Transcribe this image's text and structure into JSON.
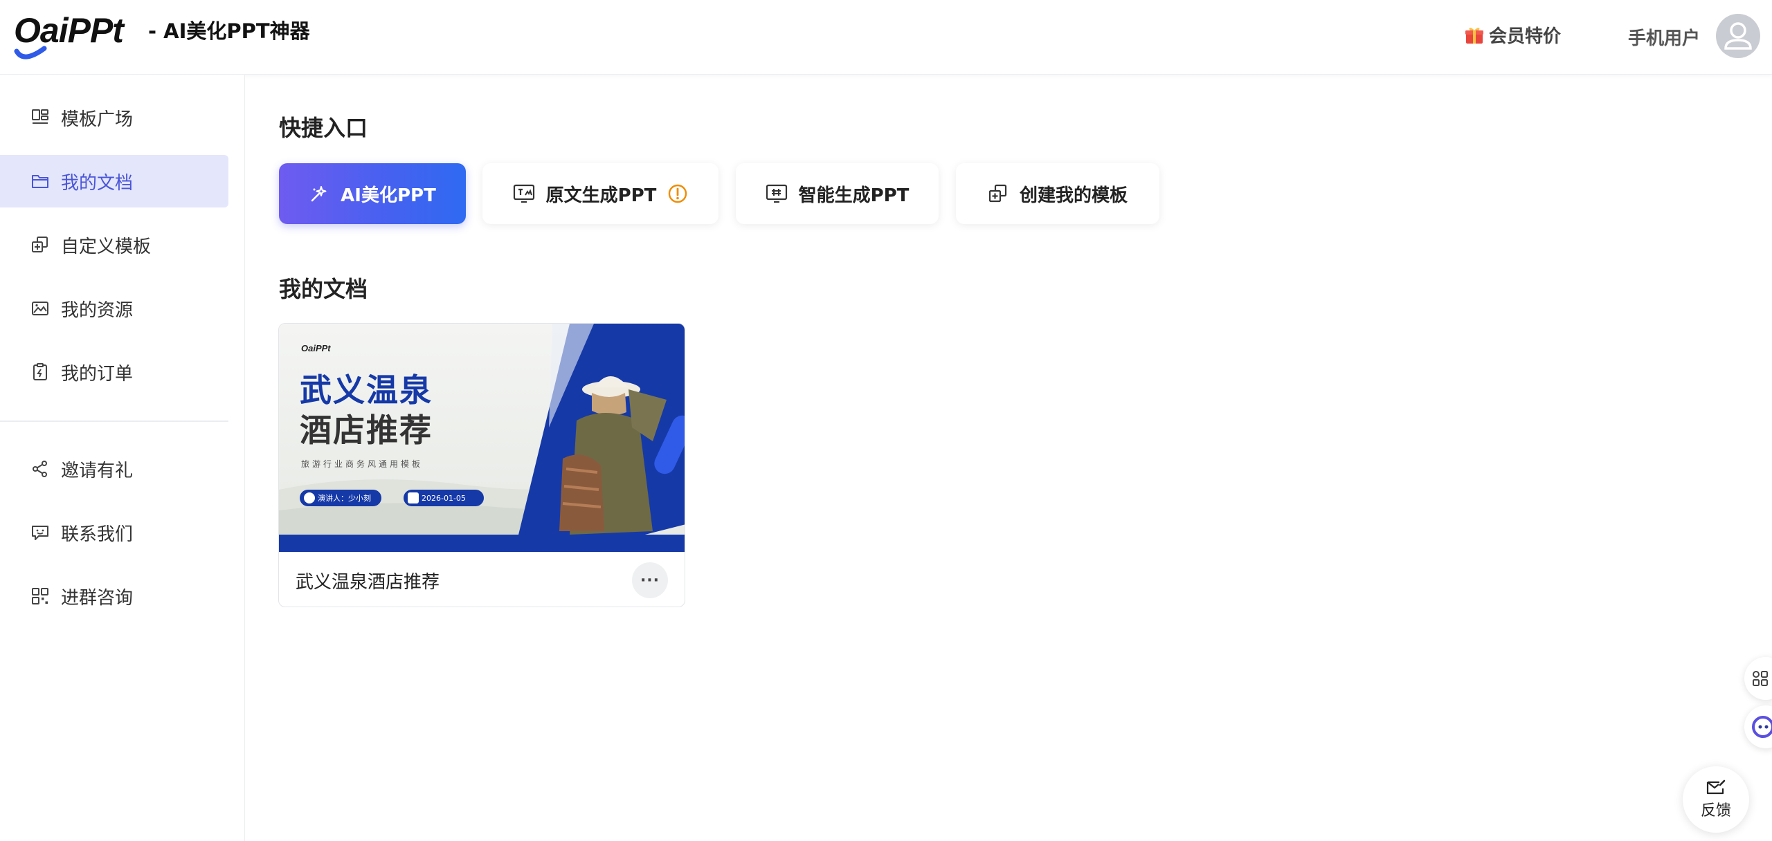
{
  "header": {
    "logo_text": "OaiPPt",
    "app_title": "- AI美化PPT神器",
    "vip_label": "会员特价",
    "user_name": "手机用户"
  },
  "sidebar": {
    "items": [
      {
        "label": "模板广场",
        "icon": "template-grid-icon"
      },
      {
        "label": "我的文档",
        "icon": "folder-icon",
        "active": true
      },
      {
        "label": "自定义模板",
        "icon": "custom-template-icon"
      },
      {
        "label": "我的资源",
        "icon": "image-resource-icon"
      },
      {
        "label": "我的订单",
        "icon": "order-clipboard-icon"
      }
    ],
    "secondary_items": [
      {
        "label": "邀请有礼",
        "icon": "share-icon"
      },
      {
        "label": "联系我们",
        "icon": "chat-icon"
      },
      {
        "label": "进群咨询",
        "icon": "qrcode-icon"
      }
    ]
  },
  "main": {
    "quick_title": "快捷入口",
    "quick_actions": [
      {
        "label": "AI美化PPT",
        "icon": "magic-wand-icon",
        "primary": true
      },
      {
        "label": "原文生成PPT",
        "icon": "text-to-slide-icon"
      },
      {
        "label": "智能生成PPT",
        "icon": "smart-slide-icon"
      },
      {
        "label": "创建我的模板",
        "icon": "create-template-icon"
      }
    ],
    "docs_title": "我的文档",
    "documents": [
      {
        "name": "武义温泉酒店推荐",
        "more_label": "···",
        "thumbnail": {
          "logo": "OaiPPt",
          "title_line1": "武义温泉",
          "title_line2": "酒店推荐",
          "subtitle": "旅游行业商务风通用模板",
          "presenter": "演讲人：少小刻",
          "date": "2026-01-05"
        }
      }
    ]
  },
  "floating": {
    "feedback_label": "反馈"
  },
  "colors": {
    "accent": "#4a55d8",
    "primary_gradient_start": "#6f5bf0",
    "primary_gradient_end": "#2f6af2",
    "thumb_blue": "#1639a8",
    "warning": "#f08c00"
  }
}
